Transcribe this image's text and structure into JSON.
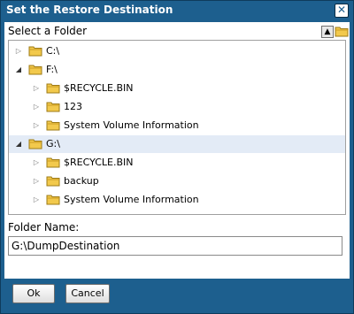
{
  "dialog": {
    "title": "Set the Restore Destination",
    "close_label": "✕",
    "select_folder_label": "Select a Folder",
    "up_label": "▲",
    "folder_name_label": "Folder Name:",
    "folder_name_value": "G:\\DumpDestination",
    "ok_label": "Ok",
    "cancel_label": "Cancel"
  },
  "tree": {
    "nodes": [
      {
        "label": "C:\\",
        "expanded": false
      },
      {
        "label": "F:\\",
        "expanded": true
      },
      {
        "label": "$RECYCLE.BIN",
        "expanded": false
      },
      {
        "label": "123",
        "expanded": false
      },
      {
        "label": "System Volume Information",
        "expanded": false
      },
      {
        "label": "G:\\",
        "expanded": true,
        "selected": true
      },
      {
        "label": "$RECYCLE.BIN",
        "expanded": false
      },
      {
        "label": "backup",
        "expanded": false
      },
      {
        "label": "System Volume Information",
        "expanded": false
      }
    ]
  },
  "colors": {
    "titlebar": "#1d5f8e",
    "folder": "#f2c94c",
    "selection": "#e3ebf6"
  }
}
